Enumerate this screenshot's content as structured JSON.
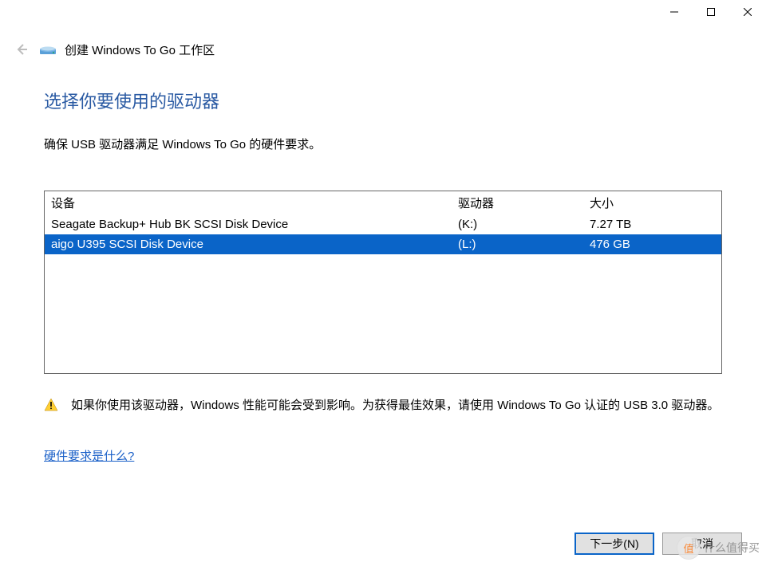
{
  "titlebar": {
    "min": "minimize",
    "max": "maximize",
    "close": "close"
  },
  "header": {
    "title": "创建 Windows To Go 工作区"
  },
  "main": {
    "heading": "选择你要使用的驱动器",
    "subtext": "确保 USB 驱动器满足 Windows To Go 的硬件要求。",
    "columns": {
      "device": "设备",
      "drive": "驱动器",
      "size": "大小"
    },
    "rows": [
      {
        "device": "Seagate Backup+ Hub BK SCSI Disk Device",
        "drive": "(K:)",
        "size": "7.27 TB",
        "selected": false
      },
      {
        "device": "aigo U395 SCSI Disk Device",
        "drive": "(L:)",
        "size": "476 GB",
        "selected": true
      }
    ],
    "warning": "如果你使用该驱动器，Windows 性能可能会受到影响。为获得最佳效果，请使用 Windows To Go 认证的 USB 3.0 驱动器。",
    "link": "硬件要求是什么?"
  },
  "footer": {
    "next": "下一步(N)",
    "cancel": "取消"
  },
  "watermark": {
    "badge": "值",
    "text": "什么值得买"
  }
}
